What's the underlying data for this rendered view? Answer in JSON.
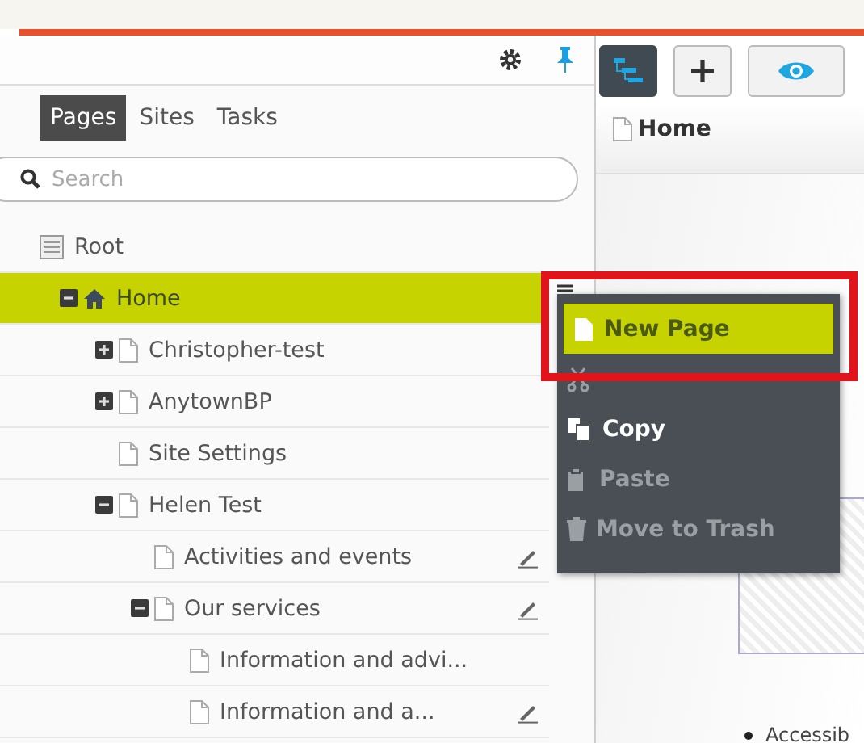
{
  "panel_tabs": [
    {
      "label": "Pages",
      "selected": true
    },
    {
      "label": "Sites",
      "selected": false
    },
    {
      "label": "Tasks",
      "selected": false
    }
  ],
  "search": {
    "placeholder": "Search"
  },
  "tree": [
    {
      "label": "Root",
      "kind": "root",
      "selected": false,
      "children": [
        {
          "label": "Home",
          "kind": "home",
          "selected": true,
          "expanded": true,
          "children": [
            {
              "label": "Christopher-test",
              "kind": "page",
              "selected": false,
              "expanded": false
            },
            {
              "label": "AnytownBP",
              "kind": "page",
              "selected": false,
              "expanded": false
            },
            {
              "label": "Site Settings",
              "kind": "page",
              "selected": false
            },
            {
              "label": "Helen Test",
              "kind": "page",
              "selected": false,
              "expanded": true,
              "children": [
                {
                  "label": "Activities and events",
                  "kind": "page",
                  "selected": false,
                  "editable": true
                },
                {
                  "label": "Our services",
                  "kind": "page",
                  "selected": false,
                  "expanded": true,
                  "editable": true,
                  "children": [
                    {
                      "label": "Information and advi...",
                      "kind": "page",
                      "selected": false
                    },
                    {
                      "label": "Information and a...",
                      "kind": "page",
                      "selected": false,
                      "editable": true
                    }
                  ]
                }
              ]
            }
          ]
        }
      ]
    }
  ],
  "breadcrumb": "Home",
  "context_menu": [
    {
      "kind": "new",
      "label": "New Page",
      "selected": true,
      "disabled": false
    },
    {
      "kind": "cut",
      "selected": false,
      "disabled": true
    },
    {
      "kind": "copy",
      "label": "Copy",
      "selected": false,
      "disabled": false
    },
    {
      "kind": "paste",
      "label": "Paste",
      "selected": false,
      "disabled": true
    },
    {
      "kind": "trash",
      "label": "Move to Trash",
      "selected": false,
      "disabled": true
    }
  ],
  "content_snippet": "Accessib"
}
